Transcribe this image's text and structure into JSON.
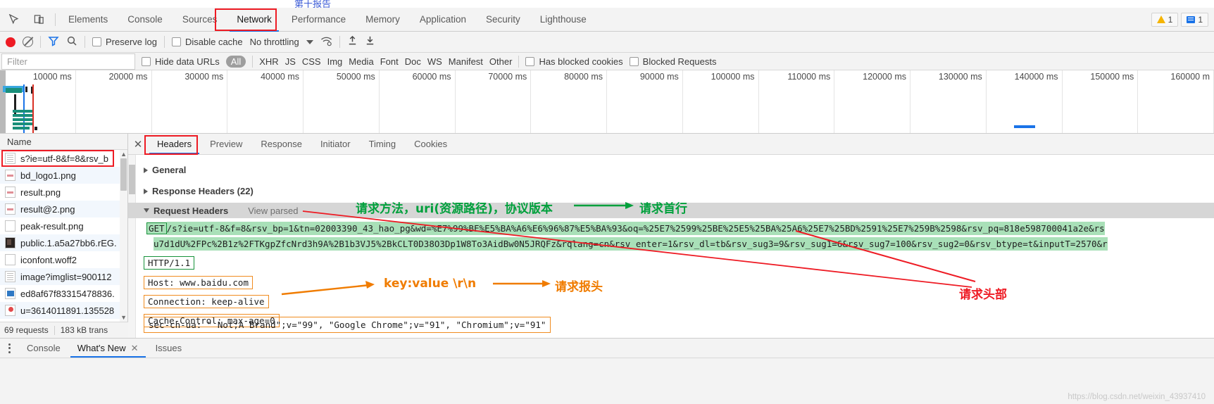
{
  "page_strip": {
    "cn_text": "第十报告"
  },
  "main_tabs": {
    "items": [
      {
        "label": "Elements",
        "active": false
      },
      {
        "label": "Console",
        "active": false
      },
      {
        "label": "Sources",
        "active": false
      },
      {
        "label": "Network",
        "active": true
      },
      {
        "label": "Performance",
        "active": false
      },
      {
        "label": "Memory",
        "active": false
      },
      {
        "label": "Application",
        "active": false
      },
      {
        "label": "Security",
        "active": false
      },
      {
        "label": "Lighthouse",
        "active": false
      }
    ],
    "inspect_icon": "inspect-element-icon",
    "device_icon": "device-toolbar-icon",
    "warning_count": "1",
    "message_count": "1"
  },
  "net_toolbar": {
    "record_icon": "record-icon",
    "clear_icon": "clear-icon",
    "filter_icon": "filter-icon",
    "search_icon": "search-icon",
    "preserve_log": "Preserve log",
    "disable_cache": "Disable cache",
    "throttling": "No throttling",
    "wifi_icon": "network-conditions-icon",
    "import_icon": "import-har-icon",
    "export_icon": "export-har-icon"
  },
  "filter_row": {
    "filter_placeholder": "Filter",
    "hide_data_urls": "Hide data URLs",
    "types": [
      "All",
      "XHR",
      "JS",
      "CSS",
      "Img",
      "Media",
      "Font",
      "Doc",
      "WS",
      "Manifest",
      "Other"
    ],
    "selected_type": "All",
    "has_blocked_cookies": "Has blocked cookies",
    "blocked_requests": "Blocked Requests"
  },
  "overview": {
    "ticks": [
      "10000 ms",
      "20000 ms",
      "30000 ms",
      "40000 ms",
      "50000 ms",
      "60000 ms",
      "70000 ms",
      "80000 ms",
      "90000 ms",
      "100000 ms",
      "110000 ms",
      "120000 ms",
      "130000 ms",
      "140000 ms",
      "150000 ms",
      "160000 m"
    ]
  },
  "request_list": {
    "column_header": "Name",
    "rows": [
      {
        "name": "s?ie=utf-8&f=8&rsv_b",
        "icon": "document-favicon",
        "selected": true
      },
      {
        "name": "bd_logo1.png",
        "icon": "image-favicon",
        "selected": false
      },
      {
        "name": "result.png",
        "icon": "image-favicon",
        "selected": false
      },
      {
        "name": "result@2.png",
        "icon": "image-favicon",
        "selected": false
      },
      {
        "name": "peak-result.png",
        "icon": "blank-favicon",
        "selected": false
      },
      {
        "name": "public.1.a5a27bb6.rEG.",
        "icon": "dark-favicon",
        "selected": false
      },
      {
        "name": "iconfont.woff2",
        "icon": "blank-favicon",
        "selected": false
      },
      {
        "name": "image?imglist=900112",
        "icon": "document-favicon",
        "selected": false
      },
      {
        "name": "ed8af67f83315478836.",
        "icon": "blue-favicon",
        "selected": false
      },
      {
        "name": "u=3614011891.135528",
        "icon": "pin-favicon",
        "selected": false
      }
    ],
    "footer_requests": "69 requests",
    "footer_transferred": "183 kB trans"
  },
  "details": {
    "tabs": [
      {
        "label": "Headers",
        "active": true
      },
      {
        "label": "Preview",
        "active": false
      },
      {
        "label": "Response",
        "active": false
      },
      {
        "label": "Initiator",
        "active": false
      },
      {
        "label": "Timing",
        "active": false
      },
      {
        "label": "Cookies",
        "active": false
      }
    ],
    "close_icon": "close-icon",
    "sections": {
      "general": "General",
      "response_headers": "Response Headers (22)",
      "request_headers": "Request Headers",
      "view_parsed": "View parsed"
    },
    "request_line": {
      "method": "GET",
      "url_part1": "/s?ie=utf-8&f=8&rsv_bp=1&tn=02003390_43_hao_pg&wd=%E7%99%BE%E5%BA%A6%E6%96%87%E5%BA%93&oq=%25E7%2599%25BE%25E5%25BA%25A6%25E7%25BD%2591%25E7%259B%2598&rsv_pq=818e598700041a2e&rs",
      "url_part2": "u7d1dU%2FPc%2B1z%2FTKgpZfcNrd3h9A%2B1b3VJ5%2BkCLT0D38O3Dp1W8To3AidBw0N5JRQFz&rqlang=cn&rsv_enter=1&rsv_dl=tb&rsv_sug3=9&rsv_sug1=6&rsv_sug7=100&rsv_sug2=0&rsv_btype=t&inputT=2570&r",
      "protocol": "HTTP/1.1"
    },
    "headers": [
      "Host: www.baidu.com",
      "Connection: keep-alive",
      "Cache-Control: max-age=0",
      "sec-ch-ua: \" Not;A Brand\";v=\"99\", \"Google Chrome\";v=\"91\", \"Chromium\";v=\"91\""
    ]
  },
  "annotations": {
    "request_line_desc": "请求方法，uri(资源路径)，协议版本",
    "request_first_line": "请求首行",
    "kv_format": "key:value \\r\\n",
    "request_headers_cn": "请求报头",
    "request_head_cn": "请求头部"
  },
  "drawer": {
    "menu_icon": "more-options-icon",
    "tabs": [
      {
        "label": "Console",
        "active": false,
        "closable": false
      },
      {
        "label": "What's New",
        "active": true,
        "closable": true
      },
      {
        "label": "Issues",
        "active": false,
        "closable": false
      }
    ],
    "close_icon": "close-icon"
  },
  "watermark": "https://blog.csdn.net/weixin_43937410"
}
